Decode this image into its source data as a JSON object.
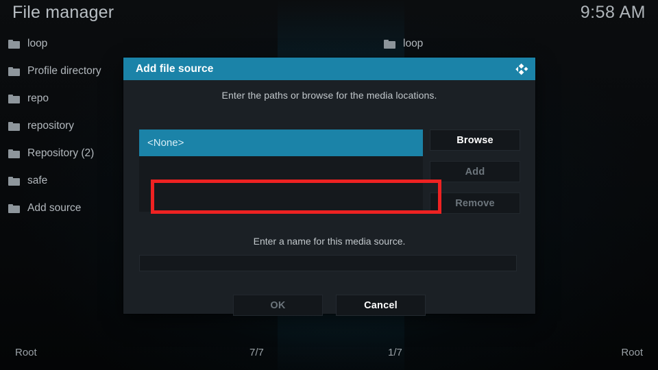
{
  "window": {
    "title": "File manager",
    "clock": "9:58 AM"
  },
  "panes": {
    "left": {
      "items": [
        {
          "label": "loop",
          "icon": "folder-icon"
        },
        {
          "label": "Profile directory",
          "icon": "folder-icon"
        },
        {
          "label": "repo",
          "icon": "folder-icon"
        },
        {
          "label": "repository",
          "icon": "folder-icon"
        },
        {
          "label": "Repository (2)",
          "icon": "folder-icon"
        },
        {
          "label": "safe",
          "icon": "folder-icon"
        },
        {
          "label": "Add source",
          "icon": "folder-icon"
        }
      ]
    },
    "right": {
      "items": [
        {
          "label": "loop",
          "icon": "folder-icon"
        }
      ]
    }
  },
  "statusbar": {
    "left_path": "Root",
    "left_count": "7/7",
    "right_count": "1/7",
    "right_path": "Root"
  },
  "dialog": {
    "title": "Add file source",
    "logo_icon": "kodi-logo-icon",
    "paths_hint": "Enter the paths or browse for the media locations.",
    "path_list": [
      {
        "label": "<None>",
        "selected": true
      }
    ],
    "side_buttons": [
      {
        "label": "Browse",
        "enabled": true
      },
      {
        "label": "Add",
        "enabled": false
      },
      {
        "label": "Remove",
        "enabled": false
      }
    ],
    "name_hint": "Enter a name for this media source.",
    "name_value": "",
    "footer_buttons": [
      {
        "label": "OK",
        "enabled": false
      },
      {
        "label": "Cancel",
        "enabled": true
      }
    ]
  },
  "colors": {
    "accent": "#1b83a8",
    "annotation": "#ee2222",
    "dialog_bg": "#1b2025",
    "button_bg": "#13171b",
    "text": "#c8cdd1",
    "text_disabled": "#6c757c"
  }
}
